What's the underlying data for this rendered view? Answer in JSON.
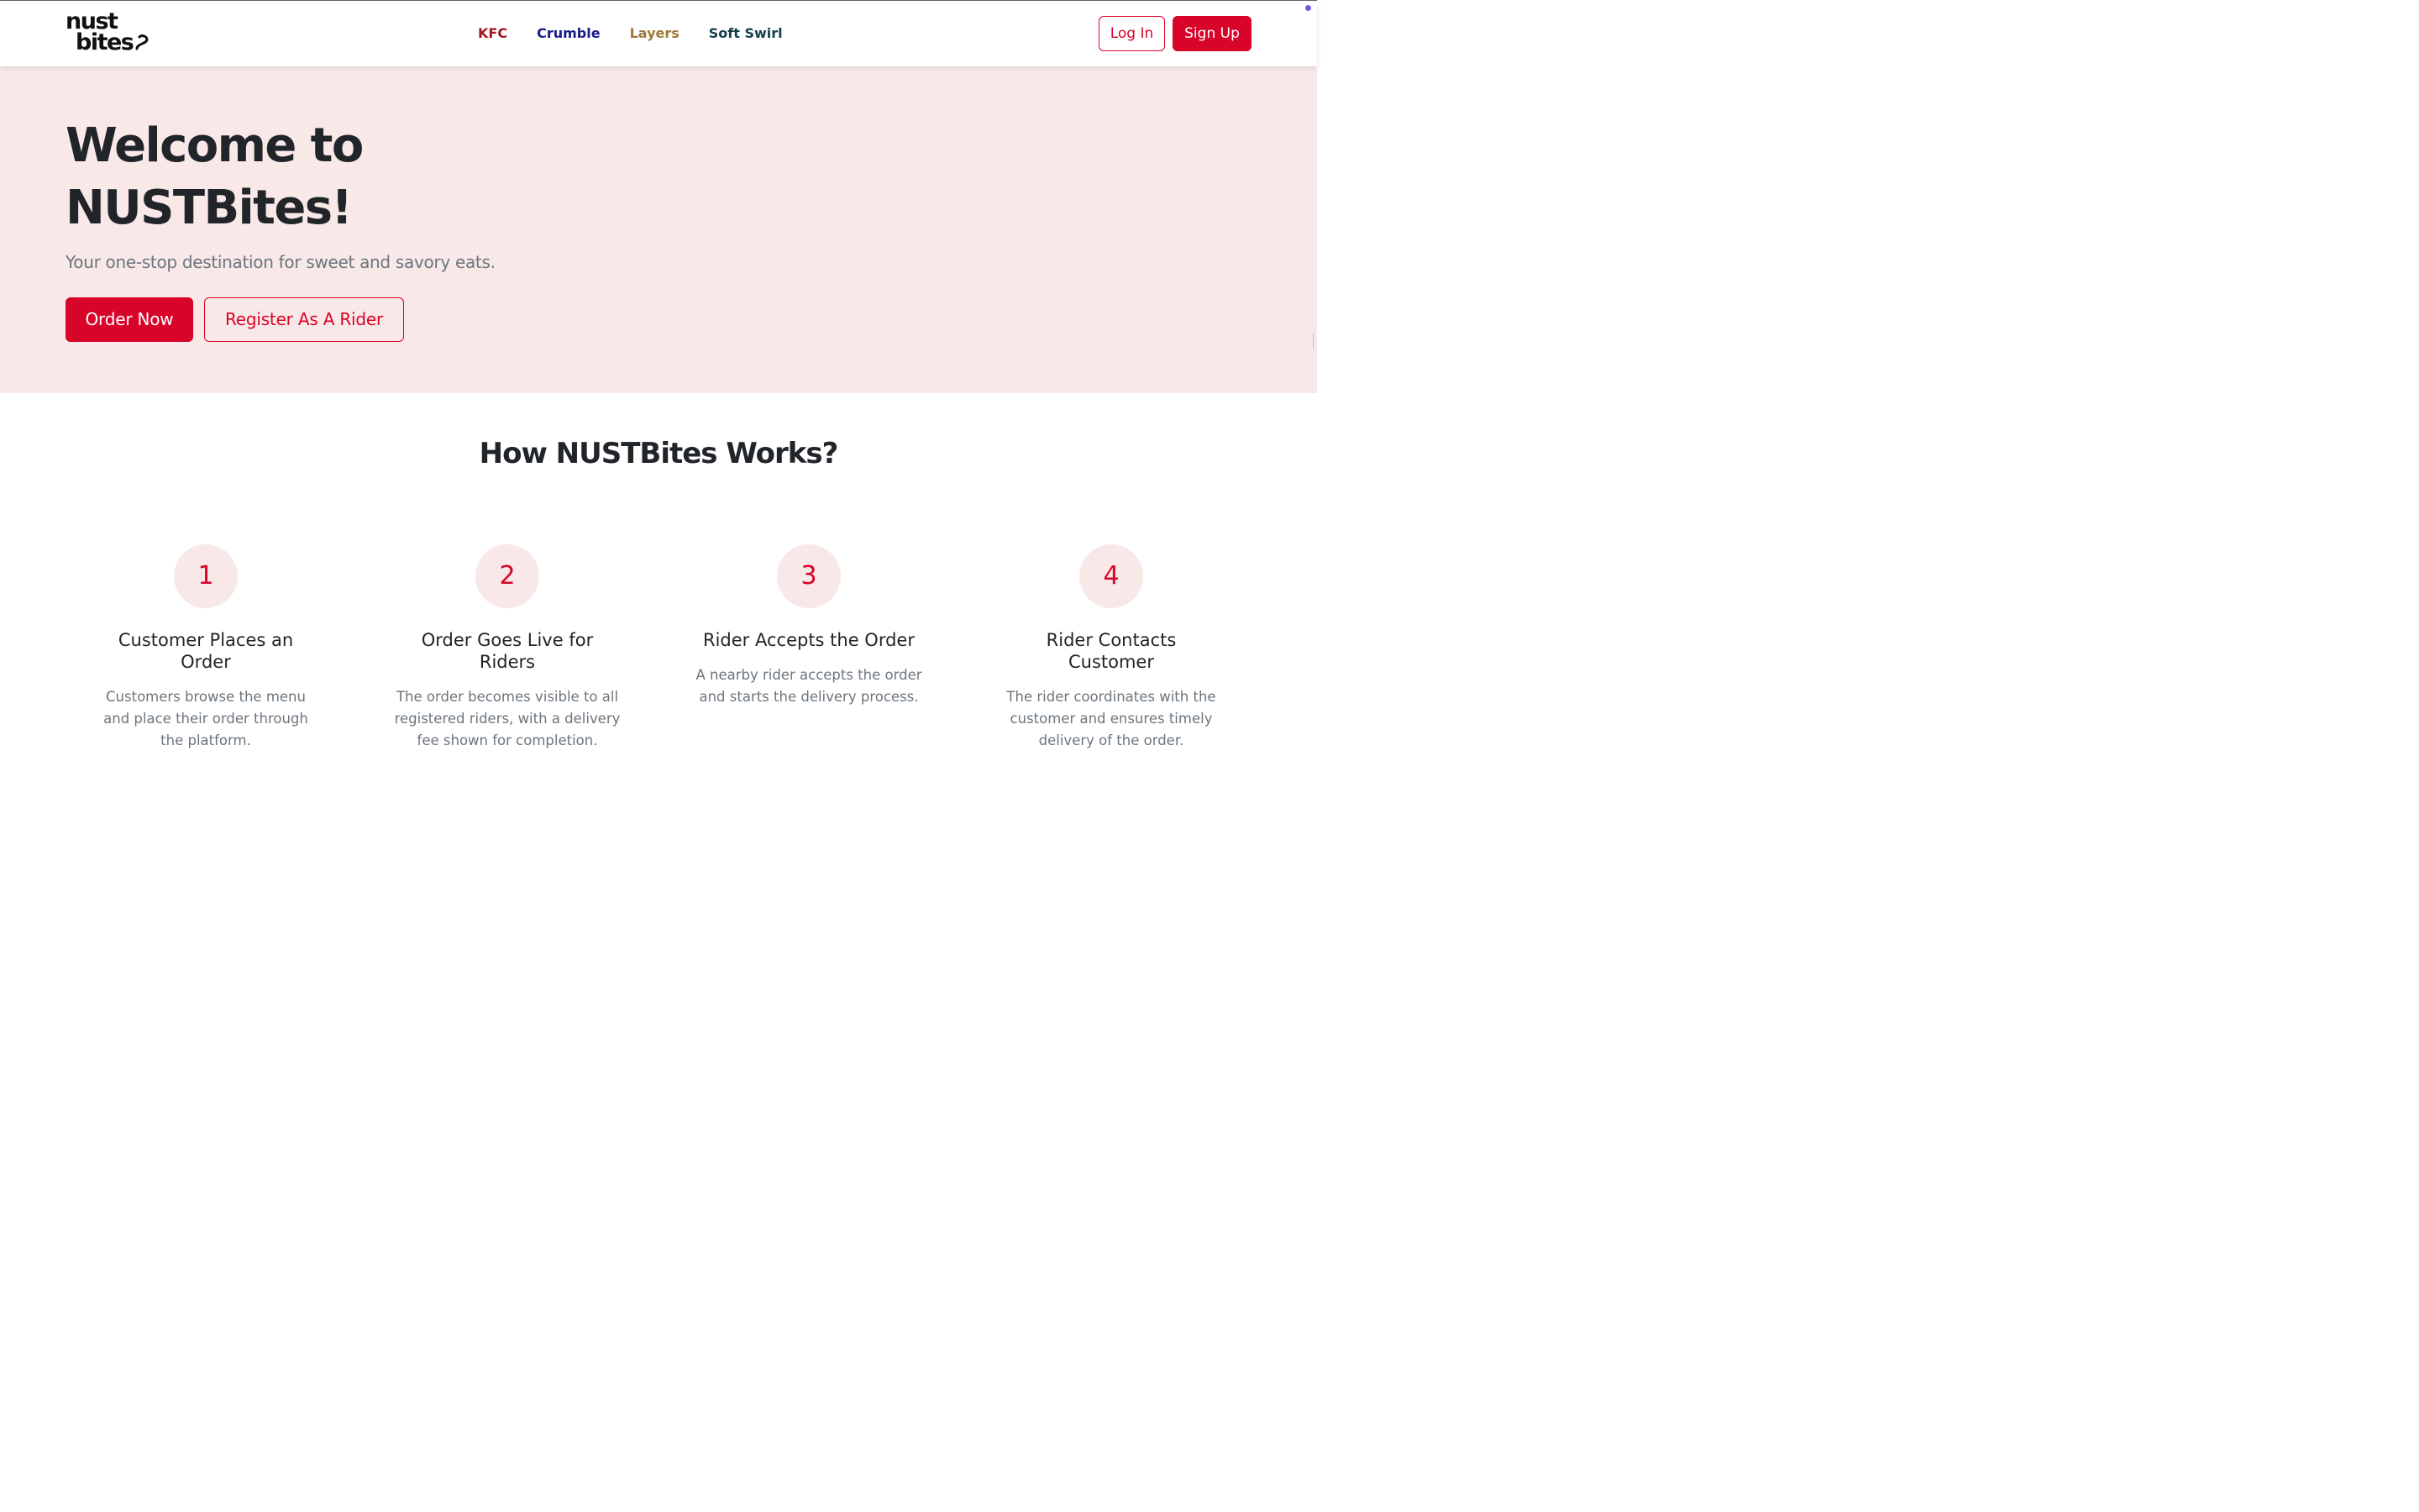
{
  "navbar": {
    "logo_line1": "nust",
    "logo_line2": "bites",
    "brands": [
      {
        "label": "KFC",
        "color": "#a31621"
      },
      {
        "label": "Crumble",
        "color": "#1a1a8c"
      },
      {
        "label": "Layers",
        "color": "#9c7a3c"
      },
      {
        "label": "Soft Swirl",
        "color": "#14404d"
      }
    ],
    "login_label": "Log In",
    "signup_label": "Sign Up"
  },
  "hero": {
    "title": "Welcome to NUSTBites!",
    "subtitle": "Your one-stop destination for sweet and savory eats.",
    "order_label": "Order Now",
    "rider_label": "Register As A Rider"
  },
  "how": {
    "title": "How NUSTBites Works?",
    "steps": [
      {
        "number": "1",
        "title": "Customer Places an Order",
        "description": "Customers browse the menu and place their order through the platform."
      },
      {
        "number": "2",
        "title": "Order Goes Live for Riders",
        "description": "The order becomes visible to all registered riders, with a delivery fee shown for completion."
      },
      {
        "number": "3",
        "title": "Rider Accepts the Order",
        "description": "A nearby rider accepts the order and starts the delivery process."
      },
      {
        "number": "4",
        "title": "Rider Contacts Customer",
        "description": "The rider coordinates with the customer and ensures timely delivery of the order."
      }
    ]
  },
  "colors": {
    "accent": "#d90429",
    "hero_background": "#f8e8e8"
  }
}
